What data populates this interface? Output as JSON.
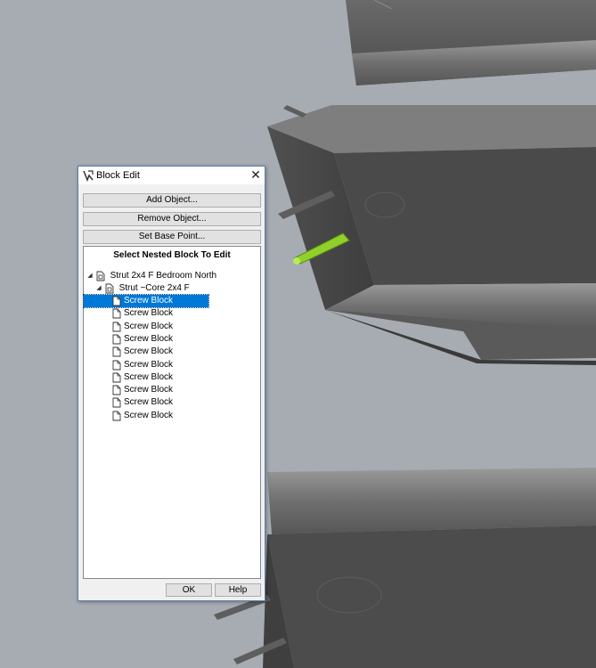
{
  "window": {
    "title": "Block Edit",
    "close_glyph": "✕",
    "icon": "block-edit-icon"
  },
  "buttons": {
    "add_object": "Add Object...",
    "remove_object": "Remove Object...",
    "set_base_point": "Set Base Point..."
  },
  "panel": {
    "heading": "Select Nested Block To Edit",
    "tree": {
      "root": {
        "label": "Strut 2x4 F Bedroom North",
        "expanded": true
      },
      "child": {
        "label": "Strut ~Core 2x4 F",
        "expanded": true
      },
      "leaves": [
        {
          "label": "Screw Block",
          "selected": true
        },
        {
          "label": "Screw Block",
          "selected": false
        },
        {
          "label": "Screw Block",
          "selected": false
        },
        {
          "label": "Screw Block",
          "selected": false
        },
        {
          "label": "Screw Block",
          "selected": false
        },
        {
          "label": "Screw Block",
          "selected": false
        },
        {
          "label": "Screw Block",
          "selected": false
        },
        {
          "label": "Screw Block",
          "selected": false
        },
        {
          "label": "Screw Block",
          "selected": false
        },
        {
          "label": "Screw Block",
          "selected": false
        }
      ]
    }
  },
  "footer": {
    "ok": "OK",
    "help": "Help"
  },
  "colors": {
    "selection": "#0078d7",
    "highlight_object": "#8fd12a",
    "background": "#a7acb2"
  }
}
